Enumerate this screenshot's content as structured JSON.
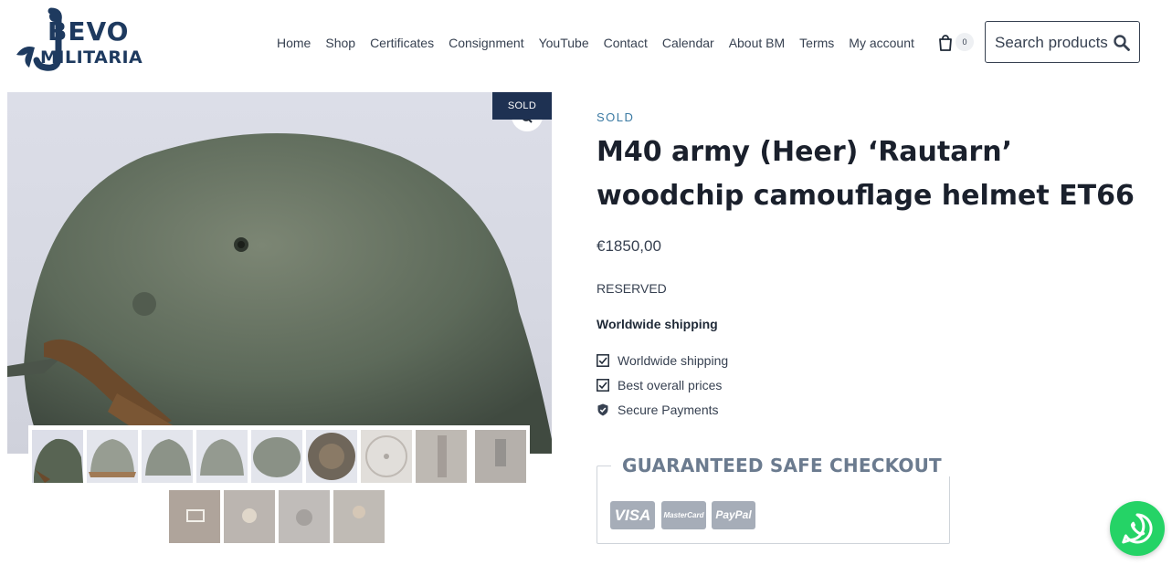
{
  "brand": {
    "line1": "BEVO",
    "line2": "MILITARIA"
  },
  "nav": [
    "Home",
    "Shop",
    "Certificates",
    "Consignment",
    "YouTube",
    "Contact",
    "Calendar",
    "About BM",
    "Terms",
    "My account"
  ],
  "cart": {
    "count": "0",
    "icon": "shopping-bag-icon"
  },
  "search": {
    "label": "Search products",
    "icon": "search-icon"
  },
  "gallery": {
    "badge": "SOLD",
    "main_image": "helmet side view",
    "zoom_icon": "magnifier-icon"
  },
  "product": {
    "status": "SOLD",
    "title": "M40 army (Heer) ‘Rautarn’ woodchip camouflage helmet ET66",
    "price": "€1850,00",
    "availability": "RESERVED",
    "shipping_heading": "Worldwide shipping",
    "features": [
      {
        "label": "Worldwide shipping",
        "icon": "checkbox-icon"
      },
      {
        "label": "Best overall prices",
        "icon": "checkbox-icon"
      },
      {
        "label": "Secure Payments",
        "icon": "shield-check-icon"
      }
    ]
  },
  "checkout": {
    "title": "GUARANTEED SAFE CHECKOUT",
    "methods": [
      "VISA",
      "MasterCard",
      "PayPal"
    ]
  },
  "colors": {
    "navy": "#1e3152",
    "accent_blue": "#3b7aa3",
    "whatsapp": "#25d366"
  }
}
